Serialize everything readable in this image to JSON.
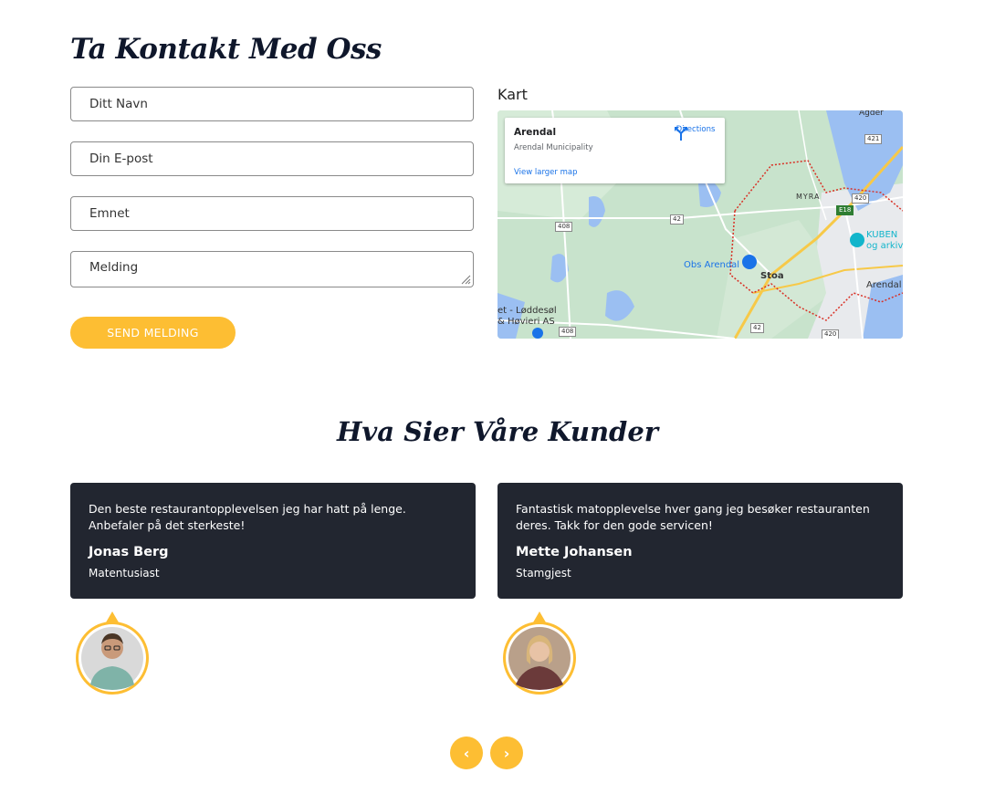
{
  "contact": {
    "title": "Ta Kontakt Med Oss",
    "fields": {
      "name_placeholder": "Ditt Navn",
      "email_placeholder": "Din E-post",
      "subject_placeholder": "Emnet",
      "message_placeholder": "Melding"
    },
    "send_label": "SEND MELDING"
  },
  "map": {
    "label": "Kart",
    "place": "Arendal",
    "place_sub": "Arendal Municipality",
    "directions_label": "Directions",
    "larger_map_label": "View larger map",
    "labels": {
      "obs": "Obs Arendal",
      "stoa": "Stoa",
      "myra": "MYRA",
      "arendal": "Arendal",
      "kuben1": "KUBEN",
      "kuben2": "og arkiv",
      "loddesol1": "et - Løddesøl",
      "loddesol2": "& Høvieri AS",
      "agder": "Agder",
      "r408a": "408",
      "r408b": "408",
      "r42a": "42",
      "r42b": "42",
      "r421": "421",
      "r420a": "420",
      "r420b": "420",
      "e18": "E18"
    }
  },
  "reviews": {
    "title": "Hva Sier Våre Kunder",
    "items": [
      {
        "text": "Den beste restaurantopplevelsen jeg har hatt på lenge. Anbefaler på det sterkeste!",
        "name": "Jonas Berg",
        "role": "Matentusiast"
      },
      {
        "text": "Fantastisk matopplevelse hver gang jeg besøker restauranten deres. Takk for den gode servicen!",
        "name": "Mette Johansen",
        "role": "Stamgjest"
      }
    ],
    "prev_icon": "‹",
    "next_icon": "›"
  },
  "colors": {
    "accent": "#fdbe33",
    "card_bg": "#222630",
    "heading": "#0f172b"
  }
}
